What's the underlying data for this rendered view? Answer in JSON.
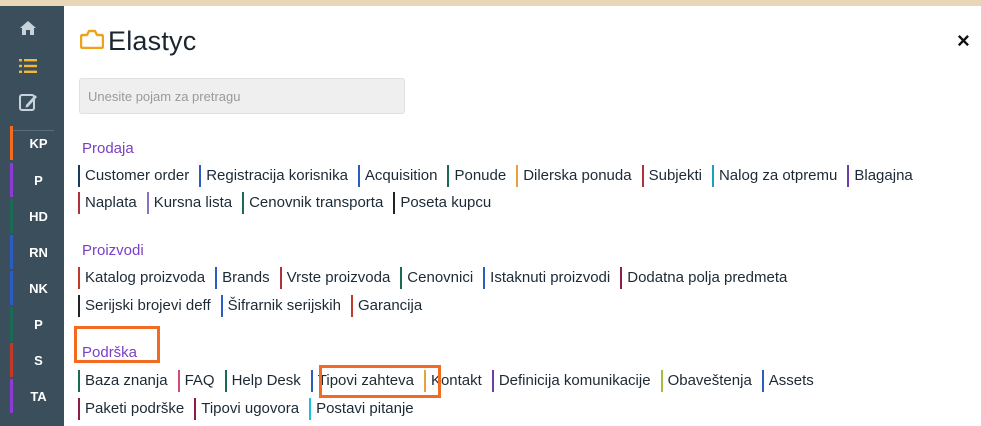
{
  "rail": {
    "items": [
      {
        "label": "KP",
        "color": "#f26b21"
      },
      {
        "label": "P",
        "color": "#8c3bd6"
      },
      {
        "label": "HD",
        "color": "#1a6b55"
      },
      {
        "label": "RN",
        "color": "#2b5cc4"
      },
      {
        "label": "NK",
        "color": "#2b5cc4"
      },
      {
        "label": "P",
        "color": "#1a6b55"
      },
      {
        "label": "S",
        "color": "#c0392b"
      },
      {
        "label": "TA",
        "color": "#8c3bd6"
      }
    ]
  },
  "brand": {
    "name": "Elastyc"
  },
  "search": {
    "placeholder": "Unesite pojam za pretragu"
  },
  "close_symbol": "×",
  "sections": [
    {
      "title": "Prodaja",
      "rows": [
        [
          {
            "label": "Customer order",
            "color": "#1b3a5c"
          },
          {
            "label": "Registracija korisnika",
            "color": "#2b5cc4"
          },
          {
            "label": "Acquisition",
            "color": "#2b5cc4"
          },
          {
            "label": "Ponude",
            "color": "#1a6b55"
          },
          {
            "label": "Dilerska ponuda",
            "color": "#e8a33b"
          },
          {
            "label": "Subjekti",
            "color": "#b0303b"
          },
          {
            "label": "Nalog za otpremu",
            "color": "#1aa0b8"
          },
          {
            "label": "Blagajna",
            "color": "#6a3fa8"
          }
        ],
        [
          {
            "label": "Naplata",
            "color": "#b0303b"
          },
          {
            "label": "Kursna lista",
            "color": "#8c6fc6"
          },
          {
            "label": "Cenovnik transporta",
            "color": "#1a6b55"
          },
          {
            "label": "Poseta kupcu",
            "color": "#222222"
          }
        ]
      ]
    },
    {
      "title": "Proizvodi",
      "rows": [
        [
          {
            "label": "Katalog proizvoda",
            "color": "#c0392b"
          },
          {
            "label": "Brands",
            "color": "#2b5cc4"
          },
          {
            "label": "Vrste proizvoda",
            "color": "#b0303b"
          },
          {
            "label": "Cenovnici",
            "color": "#1a6b55"
          },
          {
            "label": "Istaknuti proizvodi",
            "color": "#2b5cc4"
          },
          {
            "label": "Dodatna polja predmeta",
            "color": "#8c1d4a"
          }
        ],
        [
          {
            "label": "Serijski brojevi deff",
            "color": "#222222"
          },
          {
            "label": "Šifrarnik serijskih",
            "color": "#2b5cc4"
          },
          {
            "label": "Garancija",
            "color": "#c0392b"
          }
        ]
      ]
    },
    {
      "title": "Podrška",
      "rows": [
        [
          {
            "label": "Baza znanja",
            "color": "#1a6b55"
          },
          {
            "label": "FAQ",
            "color": "#d04a7a"
          },
          {
            "label": "Help Desk",
            "color": "#1a6b55"
          },
          {
            "label": "Tipovi zahteva",
            "color": "#2b5cc4"
          },
          {
            "label": "Kontakt",
            "color": "#e8a33b"
          },
          {
            "label": "Definicija komunikacije",
            "color": "#6a3fa8"
          },
          {
            "label": "Obaveštenja",
            "color": "#a0c040"
          },
          {
            "label": "Assets",
            "color": "#2b5cc4"
          }
        ],
        [
          {
            "label": "Paketi podrške",
            "color": "#8c1d4a"
          },
          {
            "label": "Tipovi ugovora",
            "color": "#8c1d4a"
          },
          {
            "label": "Postavi pitanje",
            "color": "#1ac0e0"
          }
        ]
      ]
    }
  ]
}
